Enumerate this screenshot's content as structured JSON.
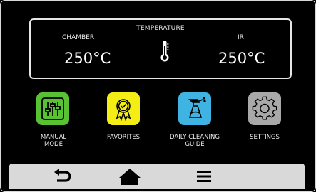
{
  "temperature": {
    "title": "TEMPERATURE",
    "chamber_label": "CHAMBER",
    "chamber_value": "250°C",
    "ir_label": "IR",
    "ir_value": "250°C",
    "icon": "thermometer-icon"
  },
  "menu": {
    "items": [
      {
        "label": "MANUAL\nMODE",
        "icon": "sliders-icon",
        "color": "#59c234"
      },
      {
        "label": "FAVORITES",
        "icon": "award-ribbon-icon",
        "color": "#f4ee15"
      },
      {
        "label": "DAILY CLEANING\nGUIDE",
        "icon": "spray-bottle-icon",
        "color": "#3fb3e2"
      },
      {
        "label": "SETTINGS",
        "icon": "gear-icon",
        "color": "#a9a9a9"
      }
    ]
  },
  "nav": {
    "back_icon": "back-arrow-icon",
    "home_icon": "home-icon",
    "menu_icon": "hamburger-menu-icon"
  }
}
